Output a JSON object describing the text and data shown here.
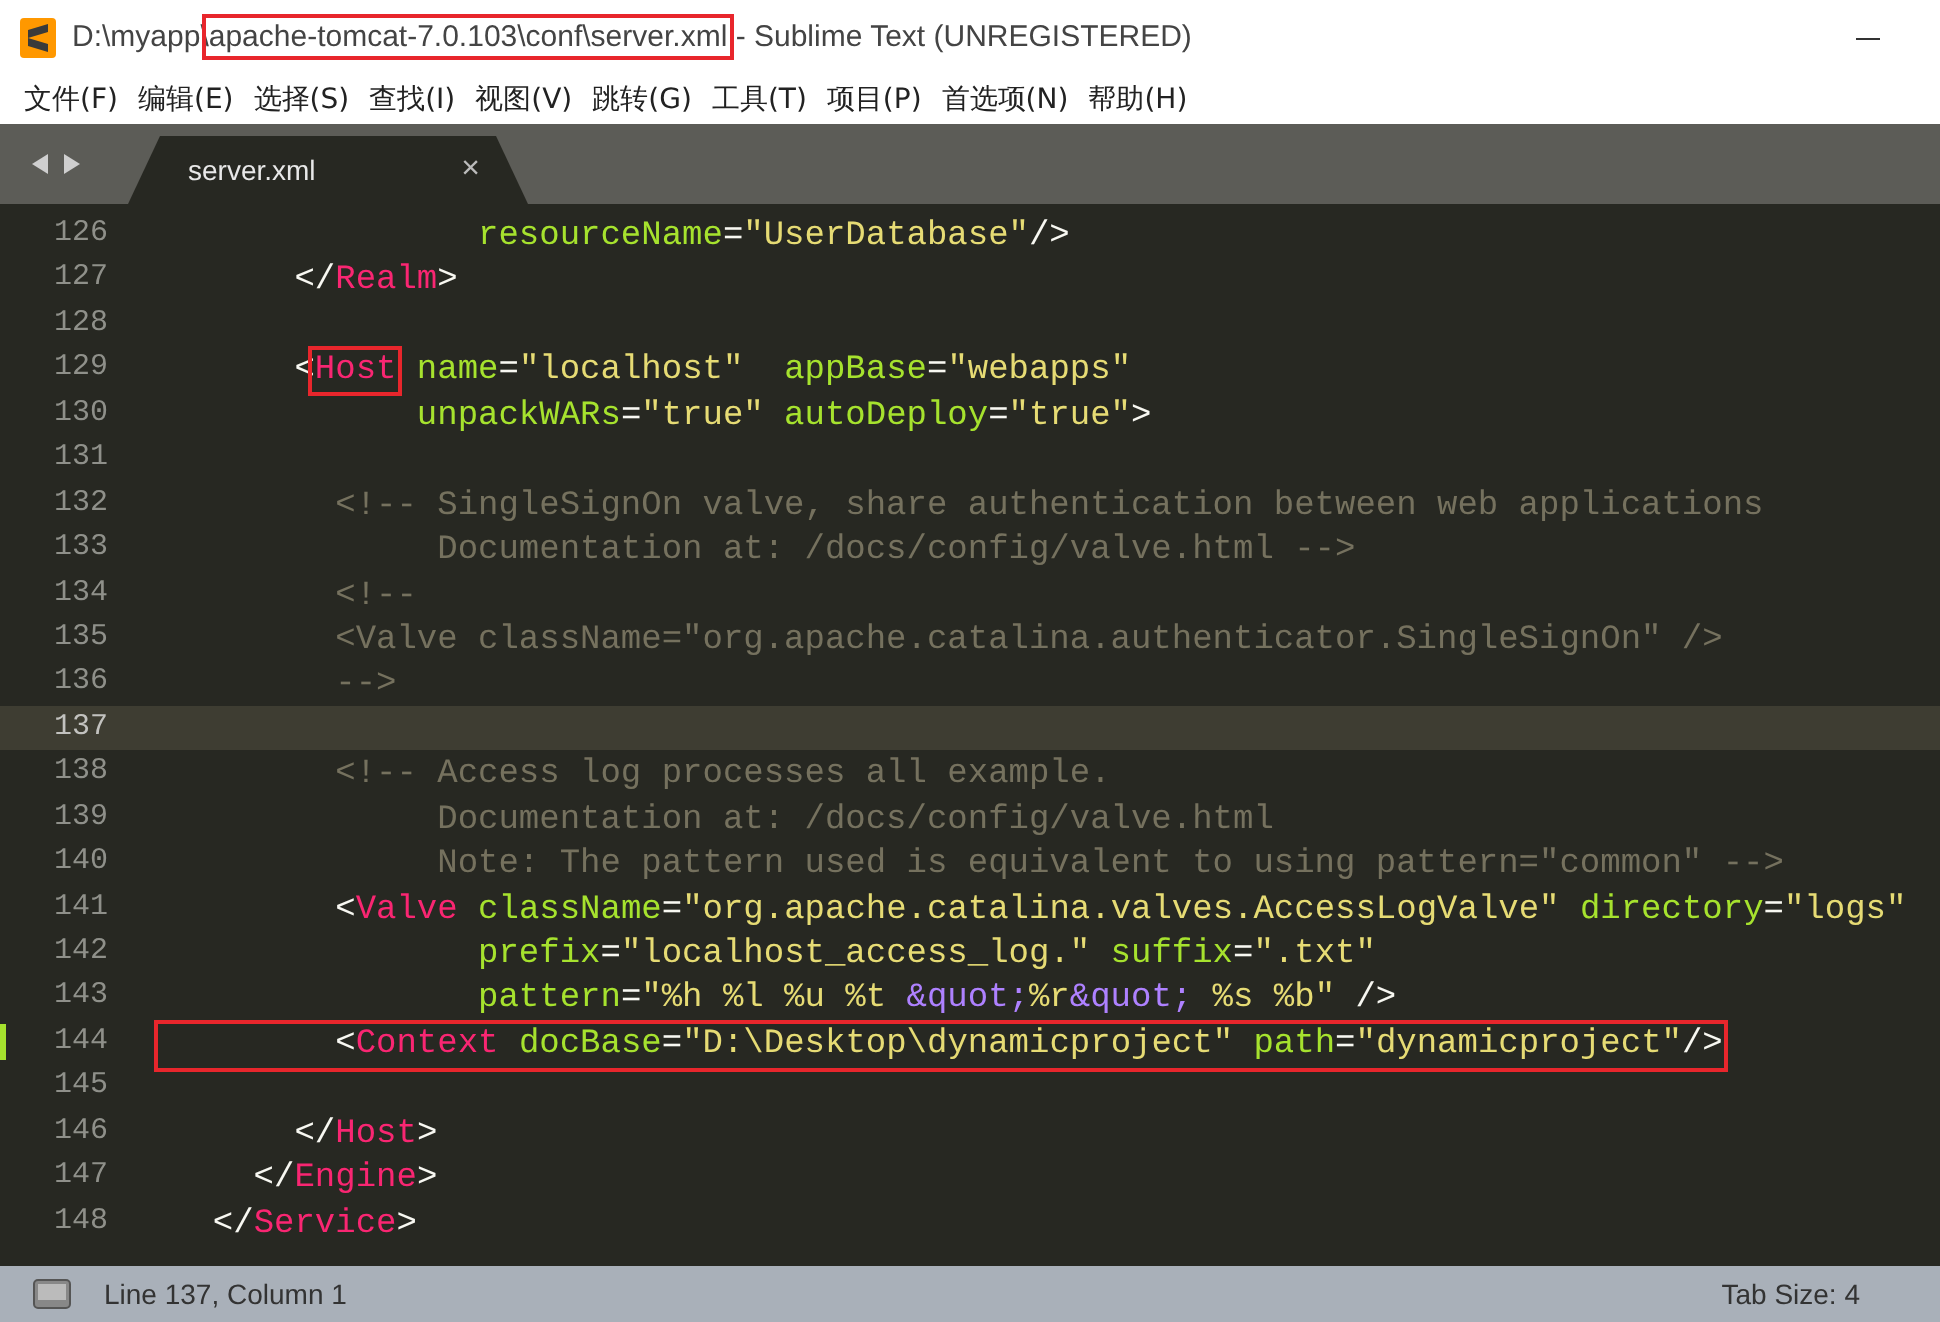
{
  "window": {
    "title_parts": [
      {
        "text": "D:\\myapp\\",
        "boxed": false
      },
      {
        "text": "apache-tomcat-7.0.103\\conf\\server.xml",
        "boxed": true
      },
      {
        "text": " - Sublime Text (UNREGISTERED)",
        "boxed": false
      }
    ]
  },
  "menu": [
    "文件(F)",
    "编辑(E)",
    "选择(S)",
    "查找(I)",
    "视图(V)",
    "跳转(G)",
    "工具(T)",
    "项目(P)",
    "首选项(N)",
    "帮助(H)"
  ],
  "tabs": [
    {
      "label": "server.xml",
      "selected": true,
      "close": "×"
    }
  ],
  "lines": [
    {
      "number": "126",
      "current": false,
      "modified": false,
      "boxed": false,
      "tokens": [
        {
          "kind": "attr",
          "text": "               resourceName"
        },
        {
          "kind": "punct",
          "text": "="
        },
        {
          "kind": "str",
          "text": "\"UserDatabase\""
        },
        {
          "kind": "punct",
          "text": "/>"
        }
      ]
    },
    {
      "number": "127",
      "current": false,
      "modified": false,
      "boxed": false,
      "tokens": [
        {
          "kind": "punct",
          "text": "      </"
        },
        {
          "kind": "tag",
          "text": "Realm"
        },
        {
          "kind": "punct",
          "text": ">"
        }
      ]
    },
    {
      "number": "128",
      "current": false,
      "modified": false
    },
    {
      "number": "129",
      "current": false,
      "modified": false,
      "boxed": false,
      "tokens": [
        {
          "kind": "punct",
          "text": "      <"
        },
        {
          "kind": "tag",
          "text": "Host",
          "boxed": true
        },
        {
          "kind": "attr",
          "text": " name"
        },
        {
          "kind": "punct",
          "text": "="
        },
        {
          "kind": "str",
          "text": "\"localhost\""
        },
        {
          "kind": "attr",
          "text": "  appBase"
        },
        {
          "kind": "punct",
          "text": "="
        },
        {
          "kind": "str",
          "text": "\"webapps\""
        }
      ]
    },
    {
      "number": "130",
      "current": false,
      "modified": false,
      "boxed": false,
      "tokens": [
        {
          "kind": "attr",
          "text": "            unpackWARs"
        },
        {
          "kind": "punct",
          "text": "="
        },
        {
          "kind": "str",
          "text": "\"true\""
        },
        {
          "kind": "attr",
          "text": " autoDeploy"
        },
        {
          "kind": "punct",
          "text": "="
        },
        {
          "kind": "str",
          "text": "\"true\""
        },
        {
          "kind": "punct",
          "text": ">"
        }
      ]
    },
    {
      "number": "131",
      "current": false,
      "modified": false
    },
    {
      "number": "132",
      "current": false,
      "modified": false,
      "boxed": false,
      "tokens": [
        {
          "kind": "comment",
          "text": "        <!-- SingleSignOn valve, share authentication between web applications"
        }
      ]
    },
    {
      "number": "133",
      "current": false,
      "modified": false,
      "boxed": false,
      "tokens": [
        {
          "kind": "comment",
          "text": "             Documentation at: /docs/config/valve.html -->"
        }
      ]
    },
    {
      "number": "134",
      "current": false,
      "modified": false,
      "boxed": false,
      "tokens": [
        {
          "kind": "comment",
          "text": "        <!--"
        }
      ]
    },
    {
      "number": "135",
      "current": false,
      "modified": false,
      "boxed": false,
      "tokens": [
        {
          "kind": "comment",
          "text": "        <Valve className=\"org.apache.catalina.authenticator.SingleSignOn\" />"
        }
      ]
    },
    {
      "number": "136",
      "current": false,
      "modified": false,
      "boxed": false,
      "tokens": [
        {
          "kind": "comment",
          "text": "        -->"
        }
      ]
    },
    {
      "number": "137",
      "current": true,
      "modified": false
    },
    {
      "number": "138",
      "current": false,
      "modified": false,
      "boxed": false,
      "tokens": [
        {
          "kind": "comment",
          "text": "        <!-- Access log processes all example."
        }
      ]
    },
    {
      "number": "139",
      "current": false,
      "modified": false,
      "boxed": false,
      "tokens": [
        {
          "kind": "comment",
          "text": "             Documentation at: /docs/config/valve.html"
        }
      ]
    },
    {
      "number": "140",
      "current": false,
      "modified": false,
      "boxed": false,
      "tokens": [
        {
          "kind": "comment",
          "text": "             Note: The pattern used is equivalent to using pattern=\"common\" -->"
        }
      ]
    },
    {
      "number": "141",
      "current": false,
      "modified": false,
      "boxed": false,
      "tokens": [
        {
          "kind": "punct",
          "text": "        <"
        },
        {
          "kind": "tag",
          "text": "Valve"
        },
        {
          "kind": "attr",
          "text": " className"
        },
        {
          "kind": "punct",
          "text": "="
        },
        {
          "kind": "str",
          "text": "\"org.apache.catalina.valves.AccessLogValve\""
        },
        {
          "kind": "attr",
          "text": " directory"
        },
        {
          "kind": "punct",
          "text": "="
        },
        {
          "kind": "str",
          "text": "\"logs\""
        }
      ]
    },
    {
      "number": "142",
      "current": false,
      "modified": false,
      "boxed": false,
      "tokens": [
        {
          "kind": "attr",
          "text": "               prefix"
        },
        {
          "kind": "punct",
          "text": "="
        },
        {
          "kind": "str",
          "text": "\"localhost_access_log.\""
        },
        {
          "kind": "attr",
          "text": " suffix"
        },
        {
          "kind": "punct",
          "text": "="
        },
        {
          "kind": "str",
          "text": "\".txt\""
        }
      ]
    },
    {
      "number": "143",
      "current": false,
      "modified": false,
      "boxed": false,
      "tokens": [
        {
          "kind": "attr",
          "text": "               pattern"
        },
        {
          "kind": "punct",
          "text": "="
        },
        {
          "kind": "str",
          "text": "\"%h %l %u %t "
        },
        {
          "kind": "entity",
          "text": "&quot;"
        },
        {
          "kind": "str",
          "text": "%r"
        },
        {
          "kind": "entity",
          "text": "&quot;"
        },
        {
          "kind": "str",
          "text": " %s %b\""
        },
        {
          "kind": "punct",
          "text": " />"
        }
      ]
    },
    {
      "number": "144",
      "current": false,
      "modified": true,
      "boxed": true,
      "tokens": [
        {
          "kind": "punct",
          "text": "        <"
        },
        {
          "kind": "tag",
          "text": "Context"
        },
        {
          "kind": "attr",
          "text": " docBase"
        },
        {
          "kind": "punct",
          "text": "="
        },
        {
          "kind": "str",
          "text": "\"D:\\Desktop\\dynamicproject\""
        },
        {
          "kind": "attr",
          "text": " path"
        },
        {
          "kind": "punct",
          "text": "="
        },
        {
          "kind": "str",
          "text": "\"dynamicproject\""
        },
        {
          "kind": "punct",
          "text": "/>"
        }
      ]
    },
    {
      "number": "145",
      "current": false,
      "modified": false
    },
    {
      "number": "146",
      "current": false,
      "modified": false,
      "boxed": false,
      "tokens": [
        {
          "kind": "punct",
          "text": "      </"
        },
        {
          "kind": "tag",
          "text": "Host"
        },
        {
          "kind": "punct",
          "text": ">"
        }
      ]
    },
    {
      "number": "147",
      "current": false,
      "modified": false,
      "boxed": false,
      "tokens": [
        {
          "kind": "punct",
          "text": "    </"
        },
        {
          "kind": "tag",
          "text": "Engine"
        },
        {
          "kind": "punct",
          "text": ">"
        }
      ]
    },
    {
      "number": "148",
      "current": false,
      "modified": false,
      "boxed": false,
      "tokens": [
        {
          "kind": "punct",
          "text": "  </"
        },
        {
          "kind": "tag",
          "text": "Service"
        },
        {
          "kind": "punct",
          "text": ">"
        }
      ]
    }
  ],
  "status_bar": {
    "position": "Line 137, Column 1",
    "tab_size": "Tab Size: 4"
  }
}
